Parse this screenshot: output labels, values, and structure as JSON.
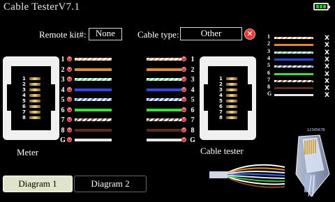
{
  "app": {
    "title": "Cable TesterV7.1"
  },
  "remote_kit": {
    "label": "Remote kit#:",
    "value": "None"
  },
  "cable_type": {
    "label": "Cable type:",
    "value": "Other"
  },
  "meter": {
    "label": "Meter",
    "pin_labels": [
      "1",
      "2",
      "3",
      "4",
      "5",
      "6",
      "7",
      "8"
    ]
  },
  "tester": {
    "label": "Cable tester",
    "pin_labels": [
      "1",
      "2",
      "3",
      "4",
      "5",
      "6",
      "7",
      "8"
    ]
  },
  "wire_rows": [
    {
      "pin": "1",
      "color": "#ffffff",
      "stripe": "#e8a060"
    },
    {
      "pin": "2",
      "color": "#d98a3a",
      "stripe": null
    },
    {
      "pin": "3",
      "color": "#ffffff",
      "stripe": "#5ad080"
    },
    {
      "pin": "4",
      "color": "#2a4ae0",
      "stripe": null
    },
    {
      "pin": "5",
      "color": "#ffffff",
      "stripe": "#4a7ae0"
    },
    {
      "pin": "6",
      "color": "#3ee03e",
      "stripe": null
    },
    {
      "pin": "7",
      "color": "#ffffff",
      "stripe": "#8a5a3a"
    },
    {
      "pin": "8",
      "color": "#5a2e1a",
      "stripe": null
    },
    {
      "pin": "G",
      "color": "#e8e8e8",
      "stripe": null
    }
  ],
  "legend": {
    "rows": [
      {
        "num": "1",
        "x": "X"
      },
      {
        "num": "2",
        "x": "X"
      },
      {
        "num": "3",
        "x": "X"
      },
      {
        "num": "4",
        "x": "X"
      },
      {
        "num": "5",
        "x": "X"
      },
      {
        "num": "6",
        "x": "X"
      },
      {
        "num": "7",
        "x": "X"
      },
      {
        "num": "8",
        "x": "X"
      },
      {
        "num": "G",
        "x": "X"
      }
    ]
  },
  "plug_caption": "12345678",
  "tabs": [
    {
      "label": "Diagram 1",
      "active": true
    },
    {
      "label": "Diagram 2",
      "active": false
    }
  ],
  "colors": {
    "active_tab_bg": "#e0e4c8",
    "error_red": "#e23a3a",
    "battery_green": "#22c22a"
  }
}
